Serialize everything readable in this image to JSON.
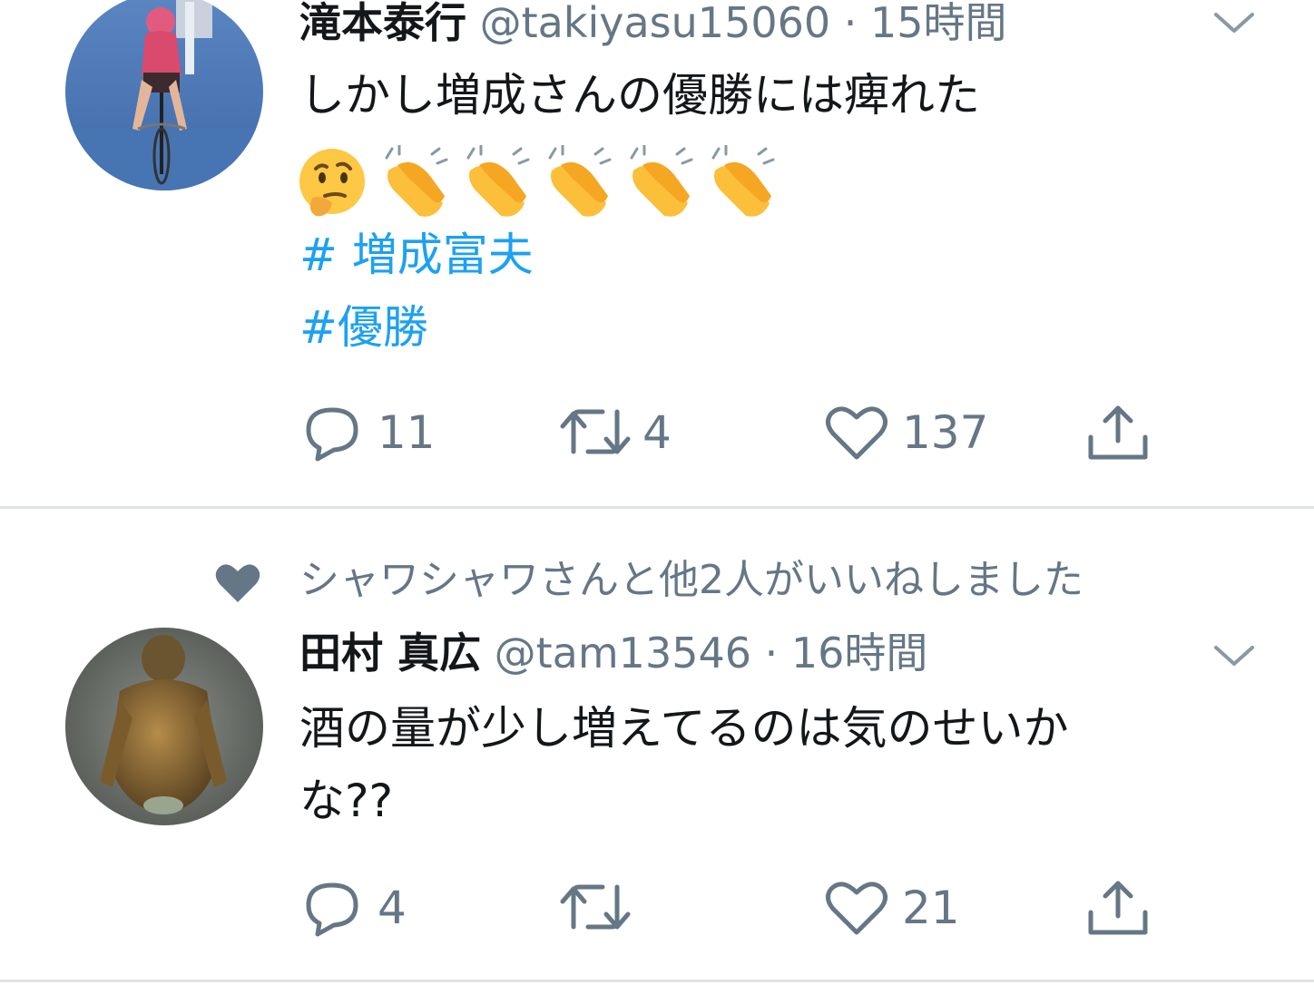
{
  "colors": {
    "text_primary": "#14171a",
    "text_secondary": "#657786",
    "link": "#1da1f2",
    "divider": "#dfe3e7",
    "icon": "#657786"
  },
  "tweets": [
    {
      "author_name": "滝本泰行",
      "handle": "@takiyasu15060",
      "separator": "·",
      "time": "15時間",
      "text": "しかし増成さんの優勝には痺れた",
      "emojis": [
        "thinking-face-emoji",
        "clapping-hands-emoji",
        "clapping-hands-emoji",
        "clapping-hands-emoji",
        "clapping-hands-emoji",
        "clapping-hands-emoji"
      ],
      "hashtags": [
        "# 増成富夫",
        "#優勝"
      ],
      "reply_count": "11",
      "retweet_count": "4",
      "like_count": "137",
      "avatar": "cyclist-avatar",
      "icons": {
        "menu": "chevron-down-icon",
        "reply": "reply-icon",
        "retweet": "retweet-icon",
        "like": "heart-outline-icon",
        "share": "share-icon"
      }
    },
    {
      "liked_by_text": "シャワシャワさんと他2人がいいねしました",
      "liked_by_icon": "heart-filled-icon",
      "author_name": "田村 真広",
      "handle": "@tam13546",
      "separator": "·",
      "time": "16時間",
      "text_line1": "酒の量が少し増えてるのは気のせいか",
      "text_line2": "な??",
      "reply_count": "4",
      "retweet_count": "",
      "like_count": "21",
      "avatar": "statue-avatar",
      "icons": {
        "menu": "chevron-down-icon",
        "reply": "reply-icon",
        "retweet": "retweet-icon",
        "like": "heart-outline-icon",
        "share": "share-icon"
      }
    }
  ]
}
